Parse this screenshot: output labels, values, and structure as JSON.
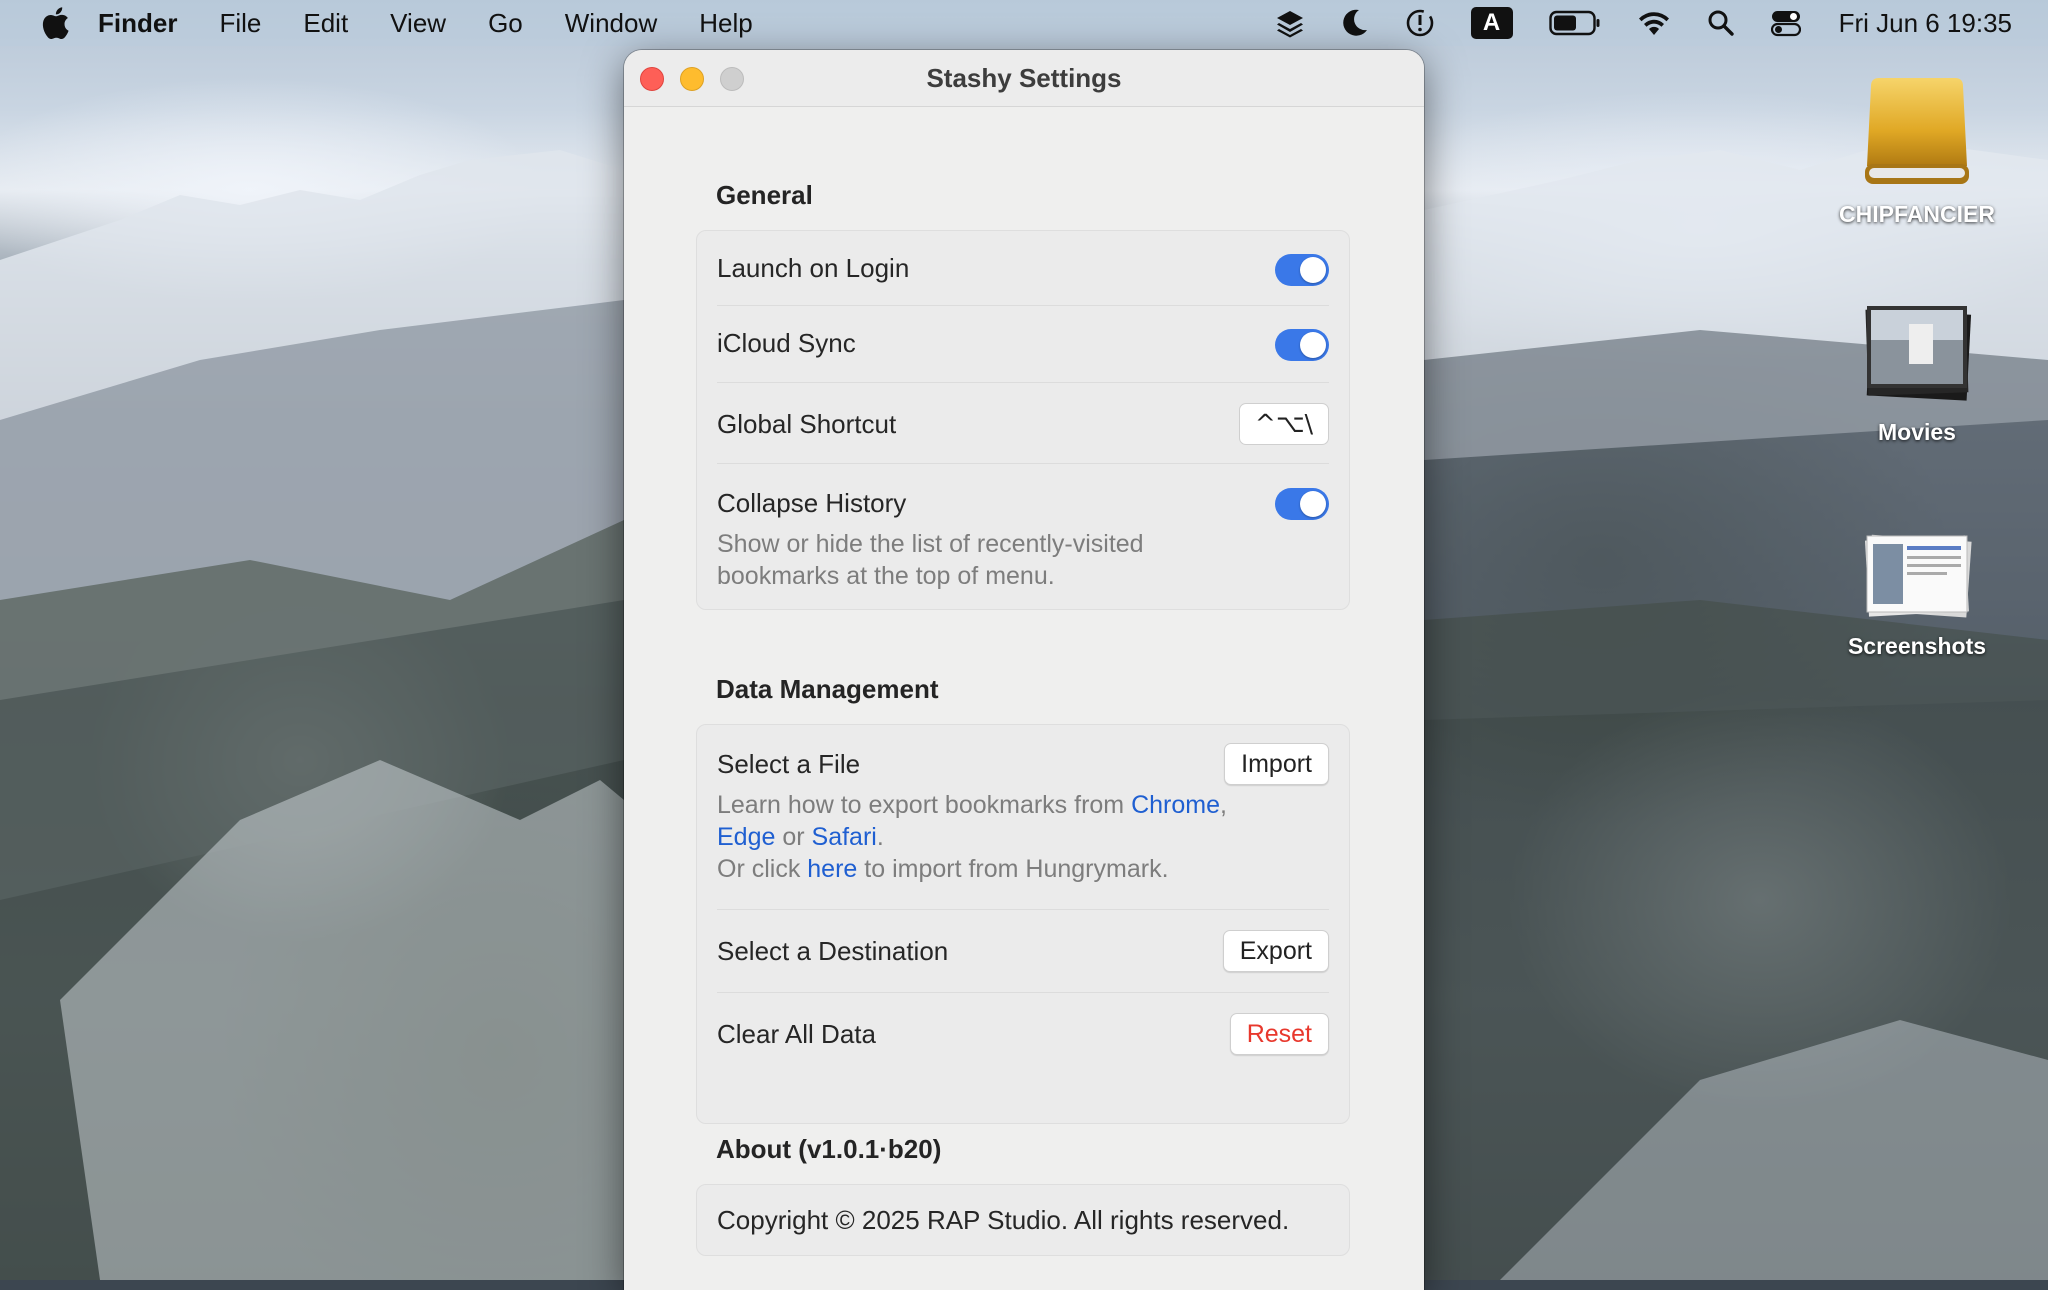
{
  "menubar": {
    "app_name": "Finder",
    "items": [
      "File",
      "Edit",
      "View",
      "Go",
      "Window",
      "Help"
    ],
    "input_source": "A",
    "clock": "Fri Jun 6  19:35"
  },
  "desktop": {
    "icons": [
      {
        "label": "CHIPFANCIER",
        "icon": "external-drive-icon"
      },
      {
        "label": "Movies",
        "icon": "folder-stack-icon"
      },
      {
        "label": "Screenshots",
        "icon": "folder-stack-icon"
      }
    ]
  },
  "window": {
    "title": "Stashy Settings",
    "general": {
      "title": "General",
      "launch_on_login": {
        "label": "Launch on Login",
        "on": true
      },
      "icloud_sync": {
        "label": "iCloud Sync",
        "on": true
      },
      "global_shortcut": {
        "label": "Global Shortcut",
        "value": "^⌥\\"
      },
      "collapse_history": {
        "label": "Collapse History",
        "on": true,
        "desc_line1": "Show or hide the list of recently-visited",
        "desc_line2": "bookmarks at the top of menu."
      }
    },
    "data_management": {
      "title": "Data Management",
      "select_file": {
        "label": "Select a File",
        "button": "Import",
        "desc_prefix": "Learn how to export bookmarks from ",
        "link_chrome": "Chrome",
        "comma": ",",
        "link_edge": "Edge",
        "or": " or ",
        "link_safari": "Safari",
        "period": ".",
        "desc2_prefix": "Or click ",
        "link_here": "here",
        "desc2_suffix": " to import from Hungrymark."
      },
      "select_destination": {
        "label": "Select a Destination",
        "button": "Export"
      },
      "clear_all": {
        "label": "Clear All Data",
        "button": "Reset"
      }
    },
    "about": {
      "title": "About (v1.0.1·b20)",
      "copyright": "Copyright © 2025 RAP Studio. All rights reserved."
    }
  },
  "colors": {
    "accent": "#3a78e8",
    "link": "#1f5fd1",
    "danger": "#e8382d"
  }
}
